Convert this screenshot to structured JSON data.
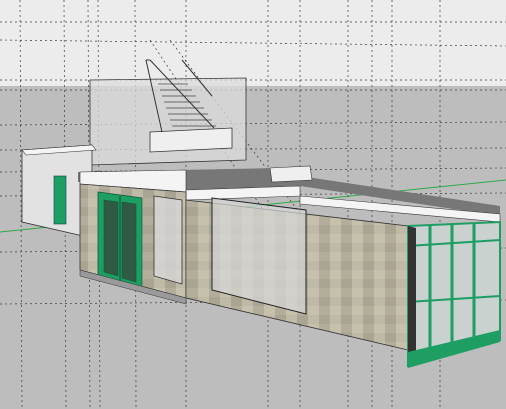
{
  "app": {
    "type": "3d-modeling-viewport",
    "view": "perspective"
  },
  "scene": {
    "sky_color": "#ececec",
    "ground_color": "#bdbdbd",
    "horizon_line_color": "#2fa84a",
    "guide_line_color": "#3a3a3a",
    "roof_color": "#777777",
    "roof_edge_color": "#f4f4f4",
    "wall_stone_color": "#b9b3a1",
    "wall_white_color": "#e2e2e2",
    "frame_color": "#1e9e63",
    "glass_color": "#c9d2cf",
    "objects": [
      "rooftop-stair-structure",
      "stair-railing",
      "main-building-block",
      "entrance-double-door",
      "side-door",
      "wall-opening",
      "glazed-corner-facade",
      "guide-lines"
    ]
  }
}
